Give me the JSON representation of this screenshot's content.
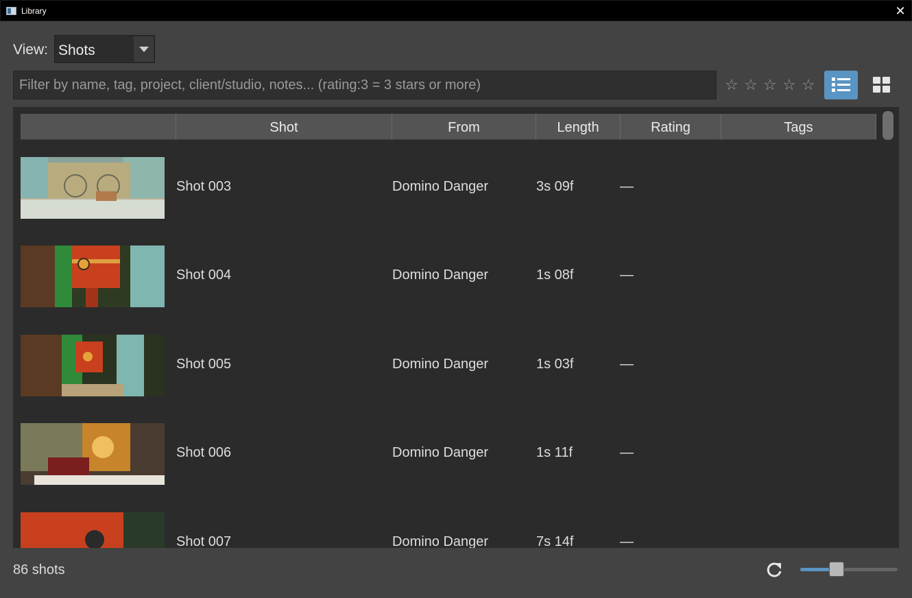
{
  "window": {
    "title": "Library",
    "close": "✕"
  },
  "view": {
    "label": "View:",
    "selected": "Shots"
  },
  "filter": {
    "placeholder": "Filter by name, tag, project, client/studio, notes... (rating:3 = 3 stars or more)",
    "value": ""
  },
  "rating_filter": {
    "stars": [
      "☆",
      "☆",
      "☆",
      "☆",
      "☆"
    ],
    "selected": 0
  },
  "view_toggle": {
    "active": "list",
    "list_icon": "list-view-icon",
    "grid_icon": "grid-view-icon"
  },
  "table": {
    "columns": [
      "",
      "Shot",
      "From",
      "Length",
      "Rating",
      "Tags"
    ],
    "rows": [
      {
        "shot": "Shot 003",
        "from": "Domino Danger",
        "length": "3s 09f",
        "rating": "—",
        "tags": ""
      },
      {
        "shot": "Shot 004",
        "from": "Domino Danger",
        "length": "1s 08f",
        "rating": "—",
        "tags": ""
      },
      {
        "shot": "Shot 005",
        "from": "Domino Danger",
        "length": "1s 03f",
        "rating": "—",
        "tags": ""
      },
      {
        "shot": "Shot 006",
        "from": "Domino Danger",
        "length": "1s 11f",
        "rating": "—",
        "tags": ""
      },
      {
        "shot": "Shot 007",
        "from": "Domino Danger",
        "length": "7s 14f",
        "rating": "—",
        "tags": ""
      }
    ]
  },
  "footer": {
    "count": "86 shots",
    "refresh_icon": "refresh-icon",
    "zoom_level": 0.35
  },
  "colors": {
    "accent": "#5a94c2",
    "background": "#434343",
    "panel": "#2b2b2b"
  }
}
